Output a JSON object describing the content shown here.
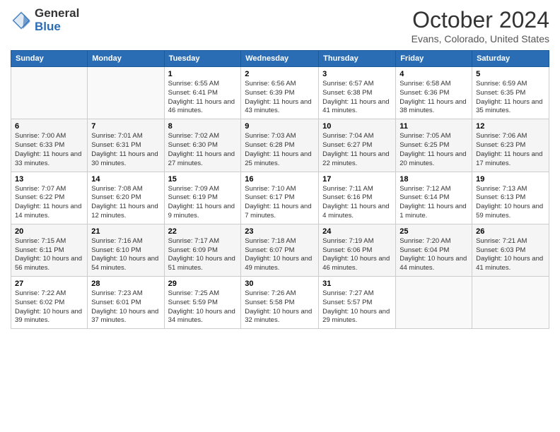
{
  "header": {
    "logo_general": "General",
    "logo_blue": "Blue",
    "month": "October 2024",
    "location": "Evans, Colorado, United States"
  },
  "weekdays": [
    "Sunday",
    "Monday",
    "Tuesday",
    "Wednesday",
    "Thursday",
    "Friday",
    "Saturday"
  ],
  "weeks": [
    [
      {
        "day": "",
        "info": ""
      },
      {
        "day": "",
        "info": ""
      },
      {
        "day": "1",
        "info": "Sunrise: 6:55 AM\nSunset: 6:41 PM\nDaylight: 11 hours and 46 minutes."
      },
      {
        "day": "2",
        "info": "Sunrise: 6:56 AM\nSunset: 6:39 PM\nDaylight: 11 hours and 43 minutes."
      },
      {
        "day": "3",
        "info": "Sunrise: 6:57 AM\nSunset: 6:38 PM\nDaylight: 11 hours and 41 minutes."
      },
      {
        "day": "4",
        "info": "Sunrise: 6:58 AM\nSunset: 6:36 PM\nDaylight: 11 hours and 38 minutes."
      },
      {
        "day": "5",
        "info": "Sunrise: 6:59 AM\nSunset: 6:35 PM\nDaylight: 11 hours and 35 minutes."
      }
    ],
    [
      {
        "day": "6",
        "info": "Sunrise: 7:00 AM\nSunset: 6:33 PM\nDaylight: 11 hours and 33 minutes."
      },
      {
        "day": "7",
        "info": "Sunrise: 7:01 AM\nSunset: 6:31 PM\nDaylight: 11 hours and 30 minutes."
      },
      {
        "day": "8",
        "info": "Sunrise: 7:02 AM\nSunset: 6:30 PM\nDaylight: 11 hours and 27 minutes."
      },
      {
        "day": "9",
        "info": "Sunrise: 7:03 AM\nSunset: 6:28 PM\nDaylight: 11 hours and 25 minutes."
      },
      {
        "day": "10",
        "info": "Sunrise: 7:04 AM\nSunset: 6:27 PM\nDaylight: 11 hours and 22 minutes."
      },
      {
        "day": "11",
        "info": "Sunrise: 7:05 AM\nSunset: 6:25 PM\nDaylight: 11 hours and 20 minutes."
      },
      {
        "day": "12",
        "info": "Sunrise: 7:06 AM\nSunset: 6:23 PM\nDaylight: 11 hours and 17 minutes."
      }
    ],
    [
      {
        "day": "13",
        "info": "Sunrise: 7:07 AM\nSunset: 6:22 PM\nDaylight: 11 hours and 14 minutes."
      },
      {
        "day": "14",
        "info": "Sunrise: 7:08 AM\nSunset: 6:20 PM\nDaylight: 11 hours and 12 minutes."
      },
      {
        "day": "15",
        "info": "Sunrise: 7:09 AM\nSunset: 6:19 PM\nDaylight: 11 hours and 9 minutes."
      },
      {
        "day": "16",
        "info": "Sunrise: 7:10 AM\nSunset: 6:17 PM\nDaylight: 11 hours and 7 minutes."
      },
      {
        "day": "17",
        "info": "Sunrise: 7:11 AM\nSunset: 6:16 PM\nDaylight: 11 hours and 4 minutes."
      },
      {
        "day": "18",
        "info": "Sunrise: 7:12 AM\nSunset: 6:14 PM\nDaylight: 11 hours and 1 minute."
      },
      {
        "day": "19",
        "info": "Sunrise: 7:13 AM\nSunset: 6:13 PM\nDaylight: 10 hours and 59 minutes."
      }
    ],
    [
      {
        "day": "20",
        "info": "Sunrise: 7:15 AM\nSunset: 6:11 PM\nDaylight: 10 hours and 56 minutes."
      },
      {
        "day": "21",
        "info": "Sunrise: 7:16 AM\nSunset: 6:10 PM\nDaylight: 10 hours and 54 minutes."
      },
      {
        "day": "22",
        "info": "Sunrise: 7:17 AM\nSunset: 6:09 PM\nDaylight: 10 hours and 51 minutes."
      },
      {
        "day": "23",
        "info": "Sunrise: 7:18 AM\nSunset: 6:07 PM\nDaylight: 10 hours and 49 minutes."
      },
      {
        "day": "24",
        "info": "Sunrise: 7:19 AM\nSunset: 6:06 PM\nDaylight: 10 hours and 46 minutes."
      },
      {
        "day": "25",
        "info": "Sunrise: 7:20 AM\nSunset: 6:04 PM\nDaylight: 10 hours and 44 minutes."
      },
      {
        "day": "26",
        "info": "Sunrise: 7:21 AM\nSunset: 6:03 PM\nDaylight: 10 hours and 41 minutes."
      }
    ],
    [
      {
        "day": "27",
        "info": "Sunrise: 7:22 AM\nSunset: 6:02 PM\nDaylight: 10 hours and 39 minutes."
      },
      {
        "day": "28",
        "info": "Sunrise: 7:23 AM\nSunset: 6:01 PM\nDaylight: 10 hours and 37 minutes."
      },
      {
        "day": "29",
        "info": "Sunrise: 7:25 AM\nSunset: 5:59 PM\nDaylight: 10 hours and 34 minutes."
      },
      {
        "day": "30",
        "info": "Sunrise: 7:26 AM\nSunset: 5:58 PM\nDaylight: 10 hours and 32 minutes."
      },
      {
        "day": "31",
        "info": "Sunrise: 7:27 AM\nSunset: 5:57 PM\nDaylight: 10 hours and 29 minutes."
      },
      {
        "day": "",
        "info": ""
      },
      {
        "day": "",
        "info": ""
      }
    ]
  ]
}
